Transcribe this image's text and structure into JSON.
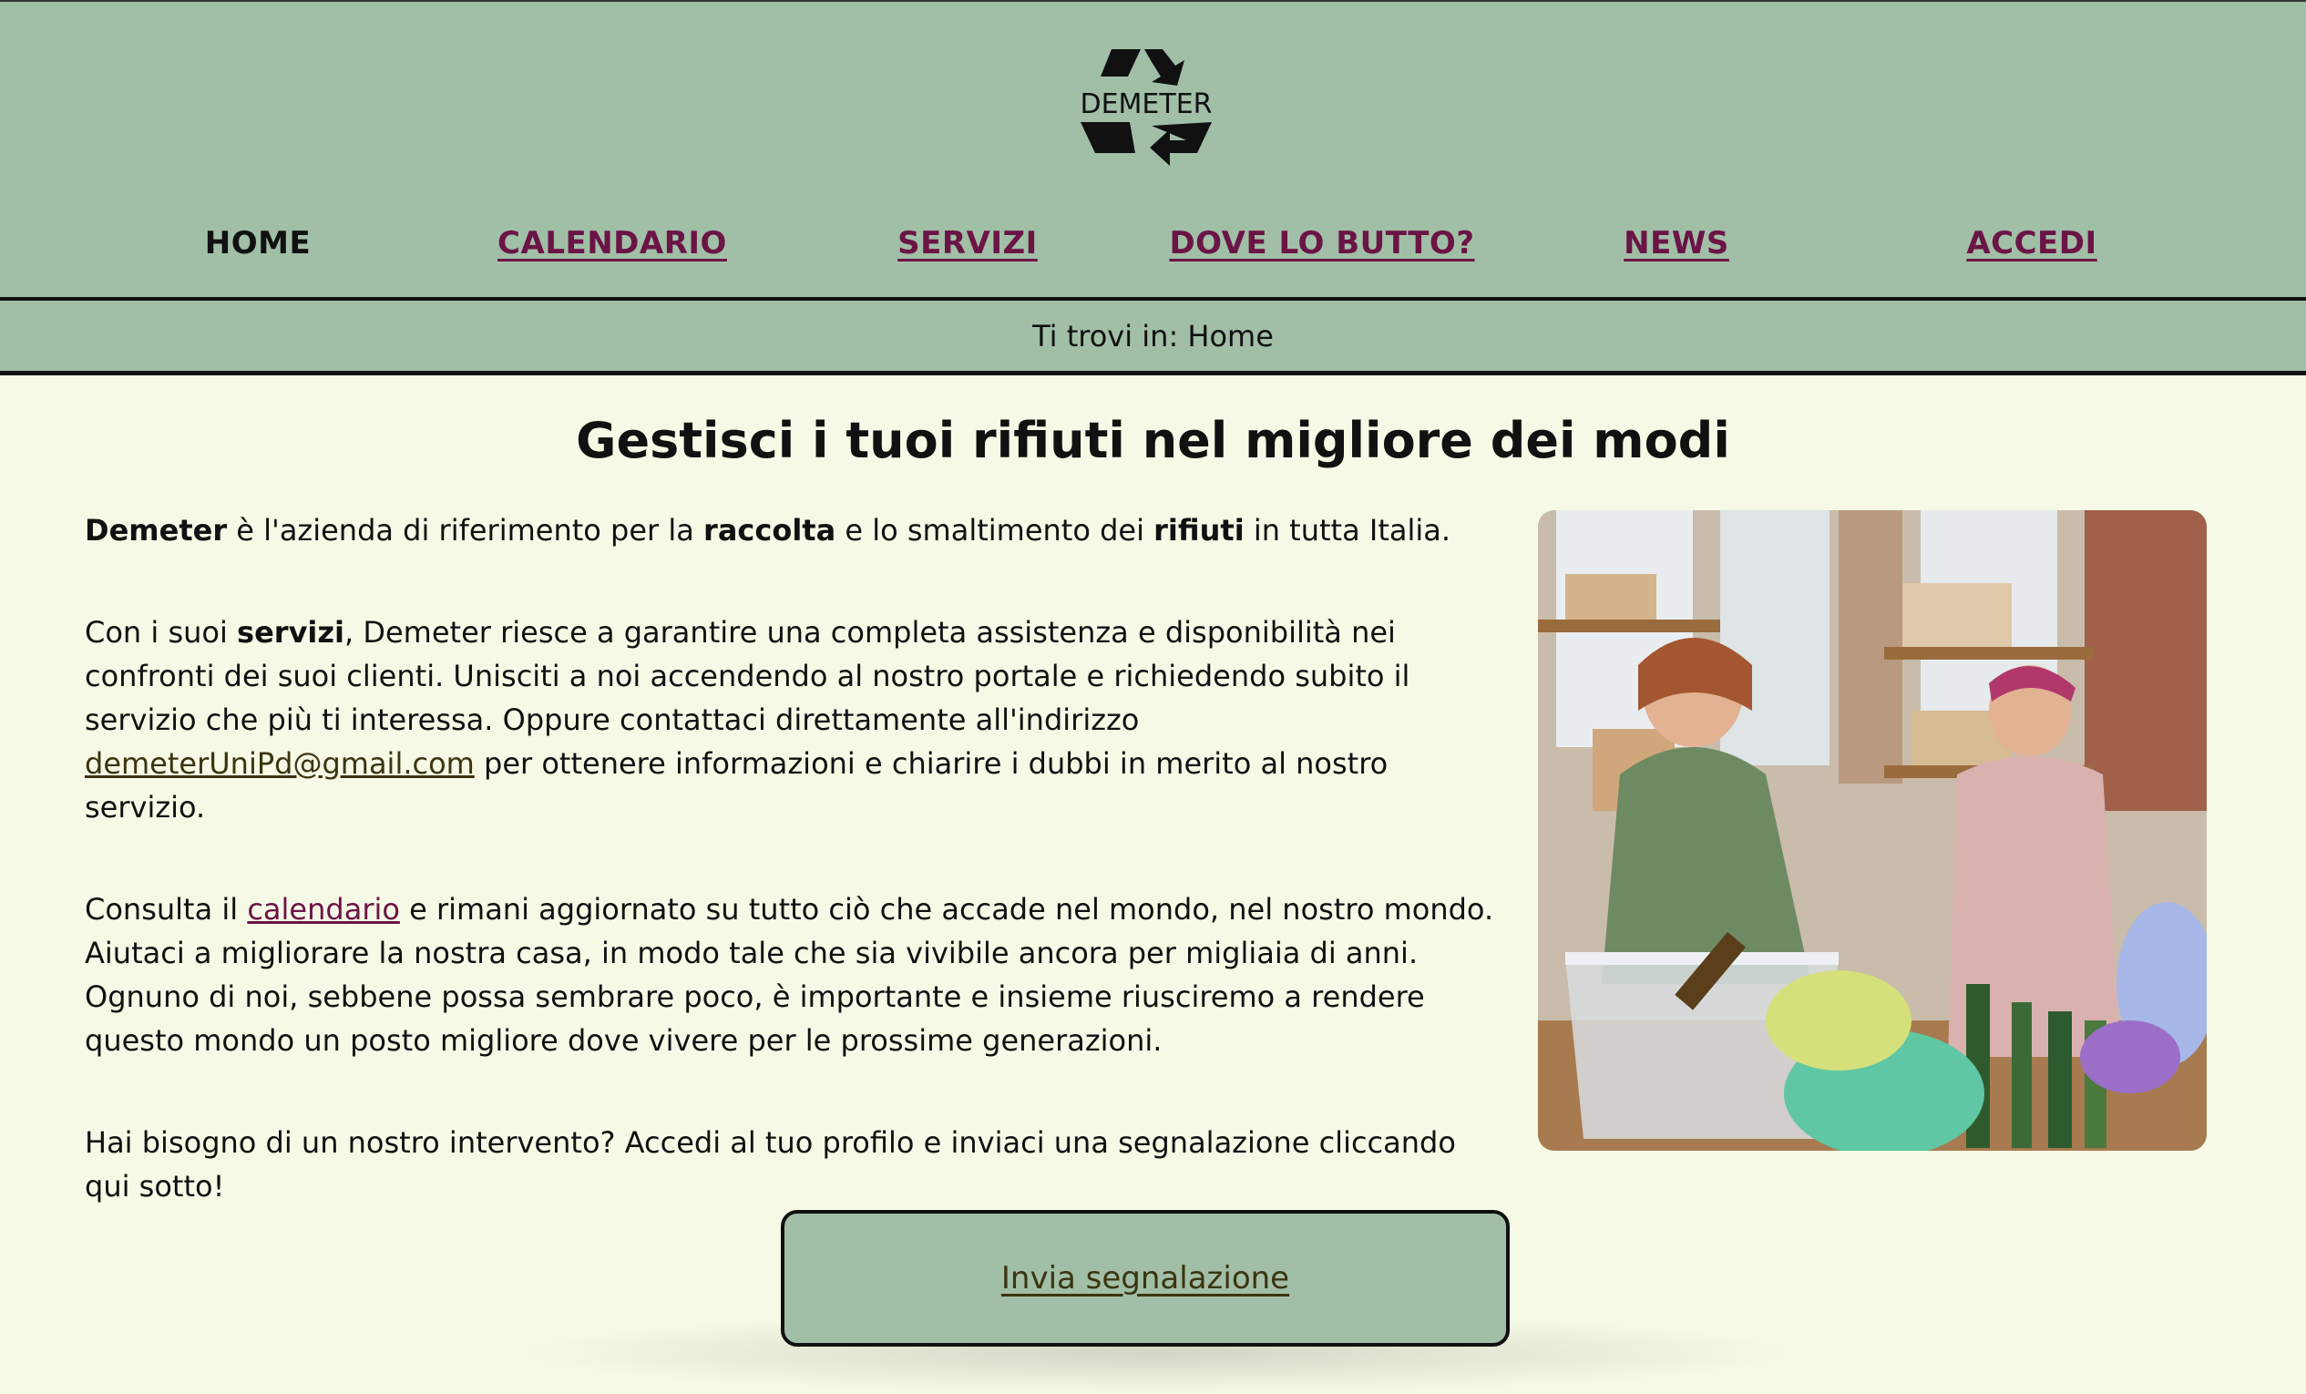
{
  "brand": {
    "logo_text": "DEMETER"
  },
  "nav": {
    "items": [
      {
        "label": "HOME",
        "current": true
      },
      {
        "label": "CALENDARIO",
        "current": false
      },
      {
        "label": "SERVIZI",
        "current": false
      },
      {
        "label": "DOVE LO BUTTO?",
        "current": false
      },
      {
        "label": "NEWS",
        "current": false
      },
      {
        "label": "ACCEDI",
        "current": false
      }
    ]
  },
  "breadcrumb": {
    "text": "Ti trovi in: Home"
  },
  "main": {
    "title": "Gestisci i tuoi rifiuti nel migliore dei modi",
    "p1": {
      "b1": "Demeter",
      "t1": " è l'azienda di riferimento per la ",
      "b2": "raccolta",
      "t2": " e lo smaltimento dei ",
      "b3": "rifiuti",
      "t3": " in tutta Italia."
    },
    "p2": {
      "t1": "Con i suoi ",
      "b1": "servizi",
      "t2": ", Demeter riesce a garantire una completa assistenza e disponibilità nei confronti dei suoi clienti. Unisciti a noi accendendo al nostro portale e richiedendo subito il servizio che più ti interessa. Oppure contattaci direttamente all'indirizzo ",
      "email": "demeterUniPd@gmail.com",
      "t3": " per ottenere informazioni e chiarire i dubbi in merito al nostro servizio."
    },
    "p3": {
      "t1": "Consulta il ",
      "link": "calendario",
      "t2": " e rimani aggiornato su tutto ciò che accade nel mondo, nel nostro mondo. Aiutaci a migliorare la nostra casa, in modo tale che sia vivibile ancora per migliaia di anni. Ognuno di noi, sebbene possa sembrare poco, è importante e insieme riusciremo a rendere questo mondo un posto migliore dove vivere per le prossime generazioni."
    },
    "p4": "Hai bisogno di un nostro intervento? Accedi al tuo profilo e inviaci una segnalazione cliccando qui sotto!",
    "cta_label": "Invia segnalazione"
  },
  "colors": {
    "header_bg": "#a1bfa7",
    "page_bg": "#f5f9e5",
    "link": "#6b1446",
    "email_link": "#3b3410"
  }
}
